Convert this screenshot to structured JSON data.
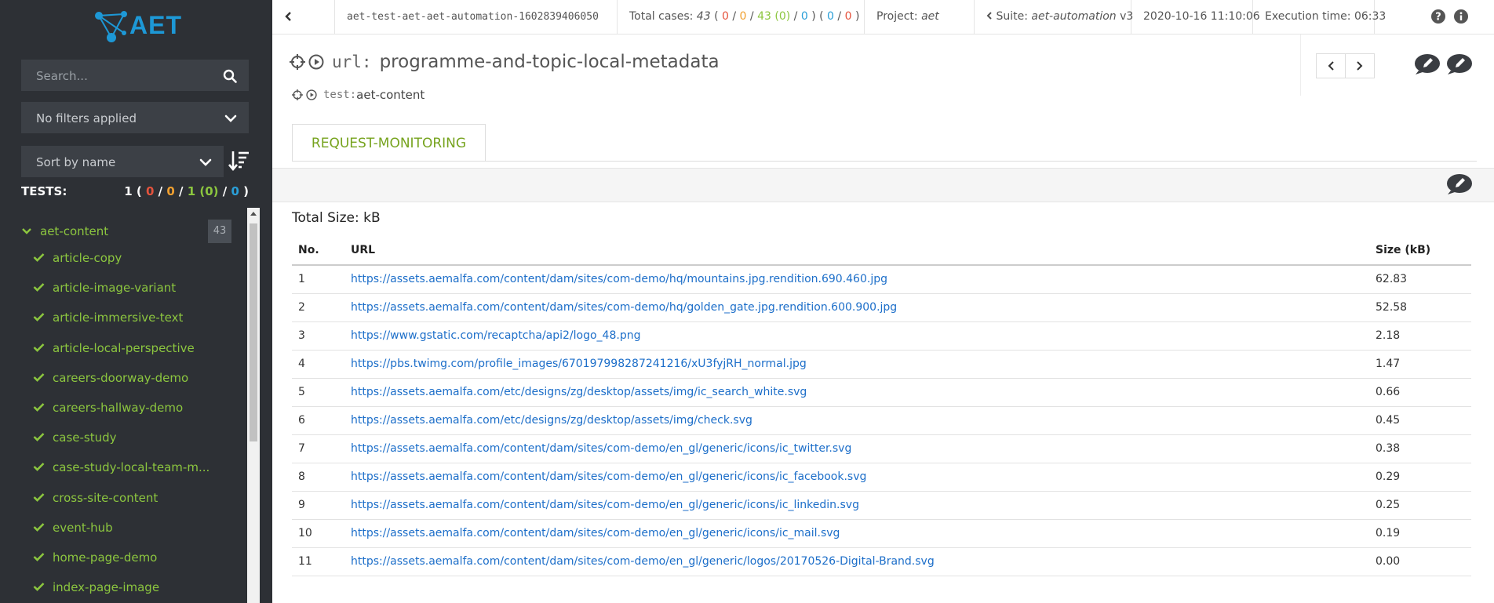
{
  "sidebar": {
    "logo_text": "AET",
    "search_placeholder": "Search...",
    "filter_label": "No filters applied",
    "sort_label": "Sort by name",
    "tests_label": "TESTS:",
    "tests_counts": {
      "total": "1",
      "open": " ( ",
      "failed": "0",
      "sep1": " / ",
      "warning": "0",
      "sep2": " / ",
      "passed": "1",
      "rebased": " (0)",
      "sep3": " / ",
      "accepted": "0",
      "close": " )"
    },
    "suite": {
      "name": "aet-content",
      "count": "43"
    },
    "tests": [
      "article-copy",
      "article-image-variant",
      "article-immersive-text",
      "article-local-perspective",
      "careers-doorway-demo",
      "careers-hallway-demo",
      "case-study",
      "case-study-local-team-m...",
      "cross-site-content",
      "event-hub",
      "home-page-demo",
      "index-page-image"
    ]
  },
  "topbar": {
    "run_id": "aet-test-aet-aet-automation-1602839406050",
    "cases_label": "Total cases: ",
    "cases_total": "43",
    "cases_open": " ( ",
    "cases_failed": "0",
    "cases_sep1": " / ",
    "cases_warning": "0",
    "cases_sep2": " / ",
    "cases_passed": "43 (0)",
    "cases_sep3": " / ",
    "cases_accepted": "0",
    "cases_mid": " ) ( ",
    "cases_a": "0",
    "cases_sep4": " / ",
    "cases_b": "0",
    "cases_close": " )",
    "project_label": "Project: ",
    "project_value": "aet",
    "suite_label": "Suite: ",
    "suite_value": "aet-automation",
    "suite_version": " v3",
    "date": "2020-10-16 11:10:06",
    "exec_label": "Execution time: ",
    "exec_value": "06:33"
  },
  "header": {
    "url_label": "url:",
    "url_value": "programme-and-topic-local-metadata",
    "test_label": "test:",
    "test_value": "aet-content",
    "tab_label": "REQUEST-MONITORING"
  },
  "content": {
    "total_size": "Total Size: kB",
    "columns": [
      "No.",
      "URL",
      "Size (kB)"
    ],
    "rows": [
      {
        "no": "1",
        "url": "https://assets.aemalfa.com/content/dam/sites/com-demo/hq/mountains.jpg.rendition.690.460.jpg",
        "size": "62.83"
      },
      {
        "no": "2",
        "url": "https://assets.aemalfa.com/content/dam/sites/com-demo/hq/golden_gate.jpg.rendition.600.900.jpg",
        "size": "52.58"
      },
      {
        "no": "3",
        "url": "https://www.gstatic.com/recaptcha/api2/logo_48.png",
        "size": "2.18"
      },
      {
        "no": "4",
        "url": "https://pbs.twimg.com/profile_images/670197998287241216/xU3fyjRH_normal.jpg",
        "size": "1.47"
      },
      {
        "no": "5",
        "url": "https://assets.aemalfa.com/etc/designs/zg/desktop/assets/img/ic_search_white.svg",
        "size": "0.66"
      },
      {
        "no": "6",
        "url": "https://assets.aemalfa.com/etc/designs/zg/desktop/assets/img/check.svg",
        "size": "0.45"
      },
      {
        "no": "7",
        "url": "https://assets.aemalfa.com/content/dam/sites/com-demo/en_gl/generic/icons/ic_twitter.svg",
        "size": "0.38"
      },
      {
        "no": "8",
        "url": "https://assets.aemalfa.com/content/dam/sites/com-demo/en_gl/generic/icons/ic_facebook.svg",
        "size": "0.29"
      },
      {
        "no": "9",
        "url": "https://assets.aemalfa.com/content/dam/sites/com-demo/en_gl/generic/icons/ic_linkedin.svg",
        "size": "0.25"
      },
      {
        "no": "10",
        "url": "https://assets.aemalfa.com/content/dam/sites/com-demo/en_gl/generic/icons/ic_mail.svg",
        "size": "0.19"
      },
      {
        "no": "11",
        "url": "https://assets.aemalfa.com/content/dam/sites/com-demo/en_gl/generic/logos/20170526-Digital-Brand.svg",
        "size": "0.00"
      }
    ]
  },
  "icons": {
    "logo": "aet-logo-icon",
    "search": "search-icon",
    "filter_toggle": "chevron-down-icon",
    "sort_direction": "sort-descending-icon",
    "back": "chevron-left-icon",
    "help": "help-icon",
    "info": "info-icon",
    "target": "crosshair-icon",
    "play": "play-icon",
    "edit": "pencil-icon",
    "comment": "comment-icon"
  },
  "colors": {
    "sidebar_bg": "#2d3035",
    "accent_green": "#8cc63f",
    "tab_green": "#76a31e",
    "link_blue": "#1c6ec9",
    "failed_red": "#e5533d",
    "warning_orange": "#f0a030",
    "accepted_blue": "#2a9fd8",
    "logo_blue": "#1d98d6"
  }
}
